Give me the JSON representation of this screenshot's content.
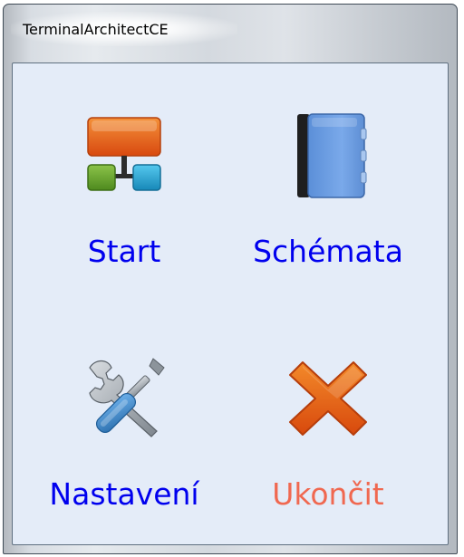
{
  "window": {
    "title": "TerminalArchitectCE"
  },
  "menu": {
    "items": [
      {
        "id": "start",
        "label": "Start",
        "icon": "diagram-icon",
        "color": "#0000ee"
      },
      {
        "id": "schemata",
        "label": "Schémata",
        "icon": "notebook-icon",
        "color": "#0000ee"
      },
      {
        "id": "nastaveni",
        "label": "Nastavení",
        "icon": "tools-icon",
        "color": "#0000ee"
      },
      {
        "id": "ukoncit",
        "label": "Ukončit",
        "icon": "close-icon",
        "color": "#f06850"
      }
    ]
  },
  "colors": {
    "client_background": "#e4ecf8",
    "label_blue": "#0000ee",
    "label_exit": "#f06850"
  }
}
